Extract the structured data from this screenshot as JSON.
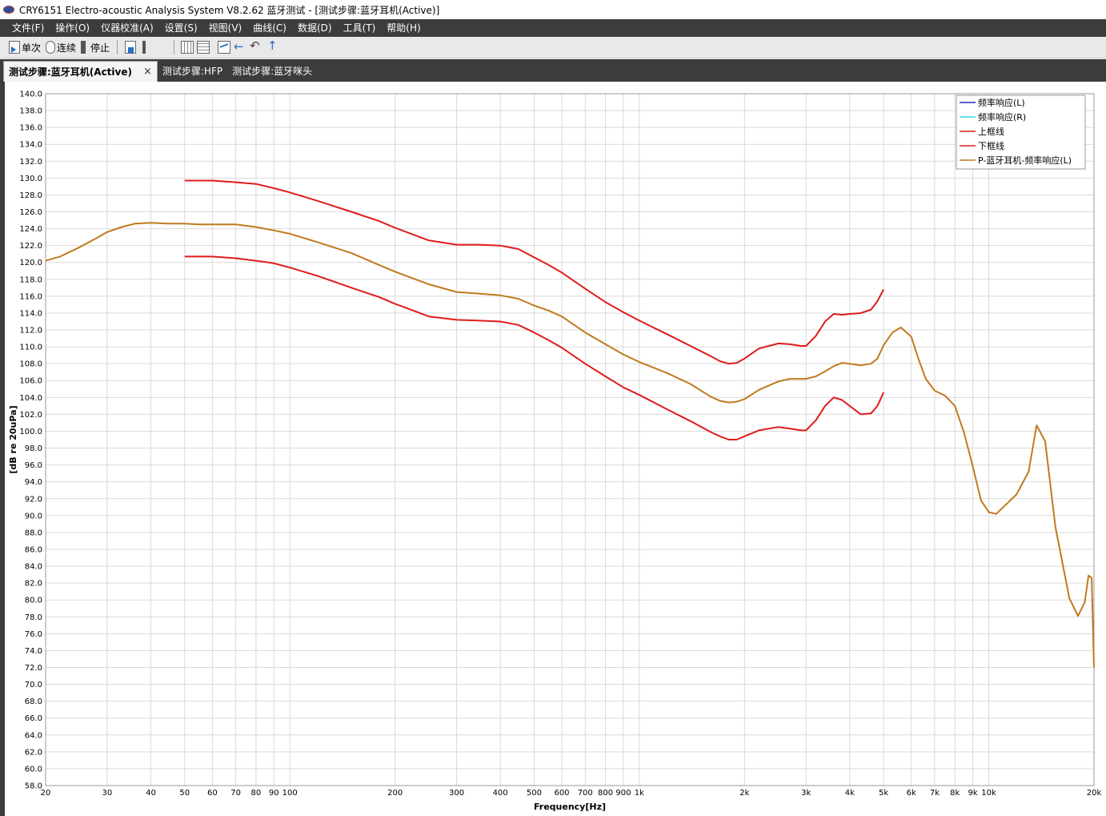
{
  "window": {
    "title": "CRY6151 Electro-acoustic Analysis System  V8.2.62 蓝牙测试 - [测试步骤:蓝牙耳机(Active)]"
  },
  "menu": {
    "items": [
      "文件(F)",
      "操作(O)",
      "仪器校准(A)",
      "设置(S)",
      "视图(V)",
      "曲线(C)",
      "数据(D)",
      "工具(T)",
      "帮助(H)"
    ]
  },
  "toolbar": {
    "single_label": "单次",
    "continuous_label": "连续",
    "stop_label": "停止",
    "icons": [
      "play-icon",
      "cylinder-icon",
      "stop-icon",
      "save-icon",
      "grid-x-icon",
      "grid-y-icon",
      "chart-icon",
      "back-arrow-icon",
      "undo-arrow-icon",
      "export-arrow-icon"
    ]
  },
  "tabs": [
    {
      "label": "测试步骤:蓝牙耳机(Active)",
      "active": true,
      "close": "×"
    },
    {
      "label": "测试步骤:HFP",
      "active": false
    },
    {
      "label": "测试步骤:蓝牙咪头",
      "active": false
    }
  ],
  "chart_data": {
    "type": "line",
    "xlabel": "Frequency[Hz]",
    "ylabel": "[dB re 20uPa]",
    "xscale": "log",
    "xlim": [
      20,
      20000
    ],
    "ylim": [
      58.0,
      140.0
    ],
    "grid": true,
    "legend_position": "top-right",
    "x_tick_labels": [
      {
        "v": 20,
        "t": "20"
      },
      {
        "v": 30,
        "t": "30"
      },
      {
        "v": 40,
        "t": "40"
      },
      {
        "v": 50,
        "t": "50"
      },
      {
        "v": 60,
        "t": "60"
      },
      {
        "v": 70,
        "t": "70"
      },
      {
        "v": 80,
        "t": "80"
      },
      {
        "v": 90,
        "t": "90"
      },
      {
        "v": 100,
        "t": "100"
      },
      {
        "v": 200,
        "t": "200"
      },
      {
        "v": 300,
        "t": "300"
      },
      {
        "v": 400,
        "t": "400"
      },
      {
        "v": 500,
        "t": "500"
      },
      {
        "v": 600,
        "t": "600"
      },
      {
        "v": 700,
        "t": "700"
      },
      {
        "v": 800,
        "t": "800"
      },
      {
        "v": 900,
        "t": "900"
      },
      {
        "v": 1000,
        "t": "1k"
      },
      {
        "v": 2000,
        "t": "2k"
      },
      {
        "v": 3000,
        "t": "3k"
      },
      {
        "v": 4000,
        "t": "4k"
      },
      {
        "v": 5000,
        "t": "5k"
      },
      {
        "v": 6000,
        "t": "6k"
      },
      {
        "v": 7000,
        "t": "7k"
      },
      {
        "v": 8000,
        "t": "8k"
      },
      {
        "v": 9000,
        "t": "9k"
      },
      {
        "v": 10000,
        "t": "10k"
      },
      {
        "v": 20000,
        "t": "20k"
      }
    ],
    "y_tick_step": 2.0,
    "legend": [
      {
        "name": "频率响应(L)",
        "color": "#1f2fbf"
      },
      {
        "name": "频率响应(R)",
        "color": "#33d6e6"
      },
      {
        "name": "上框线",
        "color": "#e01b1b"
      },
      {
        "name": "下框线",
        "color": "#e01b1b"
      },
      {
        "name": "P-蓝牙耳机-频率响应(L)",
        "color": "#c07a1e"
      }
    ],
    "series": [
      {
        "name": "上框线",
        "color": "#e01b1b",
        "points": [
          [
            50,
            129.7
          ],
          [
            60,
            129.7
          ],
          [
            70,
            129.5
          ],
          [
            80,
            129.3
          ],
          [
            90,
            128.8
          ],
          [
            100,
            128.3
          ],
          [
            120,
            127.3
          ],
          [
            150,
            126
          ],
          [
            180,
            124.9
          ],
          [
            200,
            124.1
          ],
          [
            250,
            122.6
          ],
          [
            300,
            122.1
          ],
          [
            350,
            122.1
          ],
          [
            400,
            122
          ],
          [
            450,
            121.6
          ],
          [
            500,
            120.6
          ],
          [
            550,
            119.7
          ],
          [
            600,
            118.8
          ],
          [
            700,
            116.9
          ],
          [
            800,
            115.3
          ],
          [
            900,
            114.1
          ],
          [
            1000,
            113.1
          ],
          [
            1200,
            111.5
          ],
          [
            1400,
            110.1
          ],
          [
            1600,
            108.9
          ],
          [
            1700,
            108.3
          ],
          [
            1800,
            108
          ],
          [
            1900,
            108.1
          ],
          [
            2000,
            108.6
          ],
          [
            2200,
            109.8
          ],
          [
            2500,
            110.4
          ],
          [
            2700,
            110.3
          ],
          [
            2900,
            110.1
          ],
          [
            3000,
            110.1
          ],
          [
            3200,
            111.3
          ],
          [
            3400,
            113
          ],
          [
            3600,
            113.9
          ],
          [
            3800,
            113.8
          ],
          [
            4000,
            113.9
          ],
          [
            4300,
            114
          ],
          [
            4600,
            114.4
          ],
          [
            4800,
            115.4
          ],
          [
            5000,
            116.8
          ]
        ]
      },
      {
        "name": "下框线",
        "color": "#e01b1b",
        "points": [
          [
            50,
            120.7
          ],
          [
            60,
            120.7
          ],
          [
            70,
            120.5
          ],
          [
            80,
            120.2
          ],
          [
            90,
            119.9
          ],
          [
            100,
            119.4
          ],
          [
            120,
            118.4
          ],
          [
            150,
            117
          ],
          [
            180,
            115.9
          ],
          [
            200,
            115.1
          ],
          [
            250,
            113.6
          ],
          [
            300,
            113.2
          ],
          [
            350,
            113.1
          ],
          [
            400,
            113
          ],
          [
            450,
            112.6
          ],
          [
            500,
            111.7
          ],
          [
            550,
            110.8
          ],
          [
            600,
            109.9
          ],
          [
            700,
            108
          ],
          [
            800,
            106.5
          ],
          [
            900,
            105.2
          ],
          [
            1000,
            104.3
          ],
          [
            1200,
            102.6
          ],
          [
            1400,
            101.2
          ],
          [
            1600,
            99.9
          ],
          [
            1700,
            99.4
          ],
          [
            1800,
            99
          ],
          [
            1900,
            99
          ],
          [
            2000,
            99.4
          ],
          [
            2200,
            100.1
          ],
          [
            2500,
            100.5
          ],
          [
            2700,
            100.3
          ],
          [
            2900,
            100.1
          ],
          [
            3000,
            100.1
          ],
          [
            3200,
            101.3
          ],
          [
            3400,
            103
          ],
          [
            3600,
            104
          ],
          [
            3800,
            103.7
          ],
          [
            4000,
            103
          ],
          [
            4300,
            102
          ],
          [
            4600,
            102.1
          ],
          [
            4800,
            103
          ],
          [
            5000,
            104.6
          ]
        ]
      },
      {
        "name": "P-蓝牙耳机-频率响应(L)",
        "color": "#c07a1e",
        "points": [
          [
            20,
            120.2
          ],
          [
            22,
            120.7
          ],
          [
            25,
            121.8
          ],
          [
            28,
            122.9
          ],
          [
            30,
            123.6
          ],
          [
            33,
            124.2
          ],
          [
            36,
            124.6
          ],
          [
            40,
            124.7
          ],
          [
            45,
            124.6
          ],
          [
            50,
            124.6
          ],
          [
            55,
            124.5
          ],
          [
            60,
            124.5
          ],
          [
            70,
            124.5
          ],
          [
            80,
            124.2
          ],
          [
            90,
            123.8
          ],
          [
            100,
            123.4
          ],
          [
            120,
            122.4
          ],
          [
            150,
            121.1
          ],
          [
            180,
            119.7
          ],
          [
            200,
            118.9
          ],
          [
            250,
            117.4
          ],
          [
            300,
            116.5
          ],
          [
            350,
            116.3
          ],
          [
            400,
            116.1
          ],
          [
            450,
            115.7
          ],
          [
            500,
            114.9
          ],
          [
            550,
            114.3
          ],
          [
            600,
            113.6
          ],
          [
            700,
            111.7
          ],
          [
            800,
            110.3
          ],
          [
            900,
            109.1
          ],
          [
            1000,
            108.2
          ],
          [
            1200,
            106.9
          ],
          [
            1400,
            105.6
          ],
          [
            1600,
            104.1
          ],
          [
            1700,
            103.6
          ],
          [
            1800,
            103.4
          ],
          [
            1900,
            103.5
          ],
          [
            2000,
            103.8
          ],
          [
            2200,
            104.9
          ],
          [
            2500,
            105.9
          ],
          [
            2700,
            106.2
          ],
          [
            3000,
            106.2
          ],
          [
            3200,
            106.5
          ],
          [
            3400,
            107.1
          ],
          [
            3600,
            107.7
          ],
          [
            3800,
            108.1
          ],
          [
            4000,
            108
          ],
          [
            4300,
            107.8
          ],
          [
            4600,
            108
          ],
          [
            4800,
            108.6
          ],
          [
            5000,
            110.2
          ],
          [
            5300,
            111.7
          ],
          [
            5600,
            112.3
          ],
          [
            6000,
            111.2
          ],
          [
            6300,
            108.5
          ],
          [
            6600,
            106.2
          ],
          [
            7000,
            104.8
          ],
          [
            7500,
            104.2
          ],
          [
            8000,
            103
          ],
          [
            8500,
            99.8
          ],
          [
            9000,
            95.8
          ],
          [
            9500,
            91.8
          ],
          [
            10000,
            90.4
          ],
          [
            10500,
            90.2
          ],
          [
            11000,
            91
          ],
          [
            12000,
            92.5
          ],
          [
            13000,
            95.2
          ],
          [
            13700,
            100.7
          ],
          [
            14500,
            98.8
          ],
          [
            15500,
            88.7
          ],
          [
            17000,
            80.2
          ],
          [
            18000,
            78.1
          ],
          [
            18800,
            79.7
          ],
          [
            19300,
            82.9
          ],
          [
            19700,
            82.6
          ],
          [
            20000,
            72
          ]
        ]
      }
    ]
  }
}
